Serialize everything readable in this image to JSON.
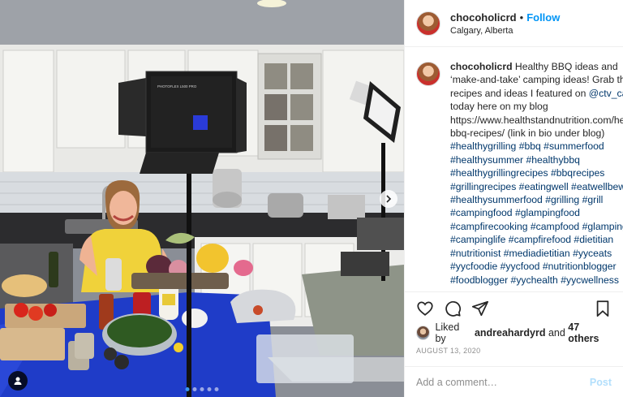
{
  "post": {
    "username": "chocoholicrd",
    "follow_label": "Follow",
    "location": "Calgary, Alberta",
    "caption": {
      "text_1": "Healthy BBQ ideas and ‘make-and-take’ camping ideas! Grab the recipes and ideas I featured on ",
      "mention": "@ctv_calgary",
      "text_2": " today here on my blog https://www.healthstandnutrition.com/healthy-bbq-recipes/ (link in bio under blog) ",
      "hashtags": "#healthygrilling #bbq #summerfood #healthysummer #healthybbq #healthygrillingrecipes #bbqrecipes #grillingrecipes #eatingwell #eatwellbewell #healthysummerfood #grilling #grill #campingfood #glampingfood #campfirecooking #campfood #glamping #campinglife #campfirefood #dietitian #nutritionist #mediadietitian #yyceats #yycfoodie #yycfood #nutritionblogger #foodblogger #yychealth #yycwellness"
    },
    "likes": {
      "prefix": "Liked by ",
      "user": "andreahardyrd",
      "middle": " and ",
      "count": "47 others"
    },
    "date": "AUGUST 13, 2020",
    "comment_placeholder": "Add a comment…",
    "post_label": "Post",
    "carousel": {
      "total": 5,
      "current": 1
    }
  },
  "photo": {
    "light_panel_label": "PHOTOFLEX L500 PRO"
  },
  "icons": {
    "like": "heart-icon",
    "comment": "comment-icon",
    "share": "share-icon",
    "save": "bookmark-icon",
    "next": "chevron-right-icon",
    "tag": "user-tag-icon"
  },
  "colors": {
    "link": "#00376b",
    "follow": "#0095f6",
    "post_disabled": "#b2dffc"
  }
}
